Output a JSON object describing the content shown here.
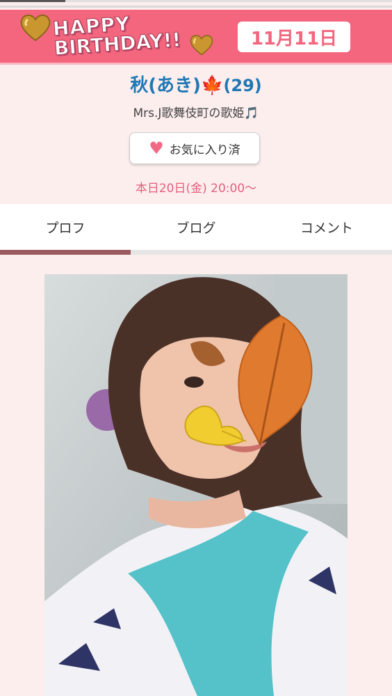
{
  "banner": {
    "happy": "HAPPY",
    "birthday": "BIRTHDAY!!",
    "date": "11月11日"
  },
  "profile": {
    "name": "秋(あき)",
    "name_icon": "maple-leaf-icon",
    "age": "(29)",
    "tagline": "Mrs.J歌舞伎町の歌姫🎵",
    "favorite_label": "お気に入り済",
    "schedule": "本日20日(金) 20:00〜"
  },
  "tabs": [
    {
      "label": "プロフ",
      "active": true
    },
    {
      "label": "ブログ",
      "active": false
    },
    {
      "label": "コメント",
      "active": false
    }
  ],
  "colors": {
    "banner": "#f3667e",
    "name": "#1f78b4",
    "schedule": "#e25f7c",
    "active_tab": "#9a5a5e"
  }
}
